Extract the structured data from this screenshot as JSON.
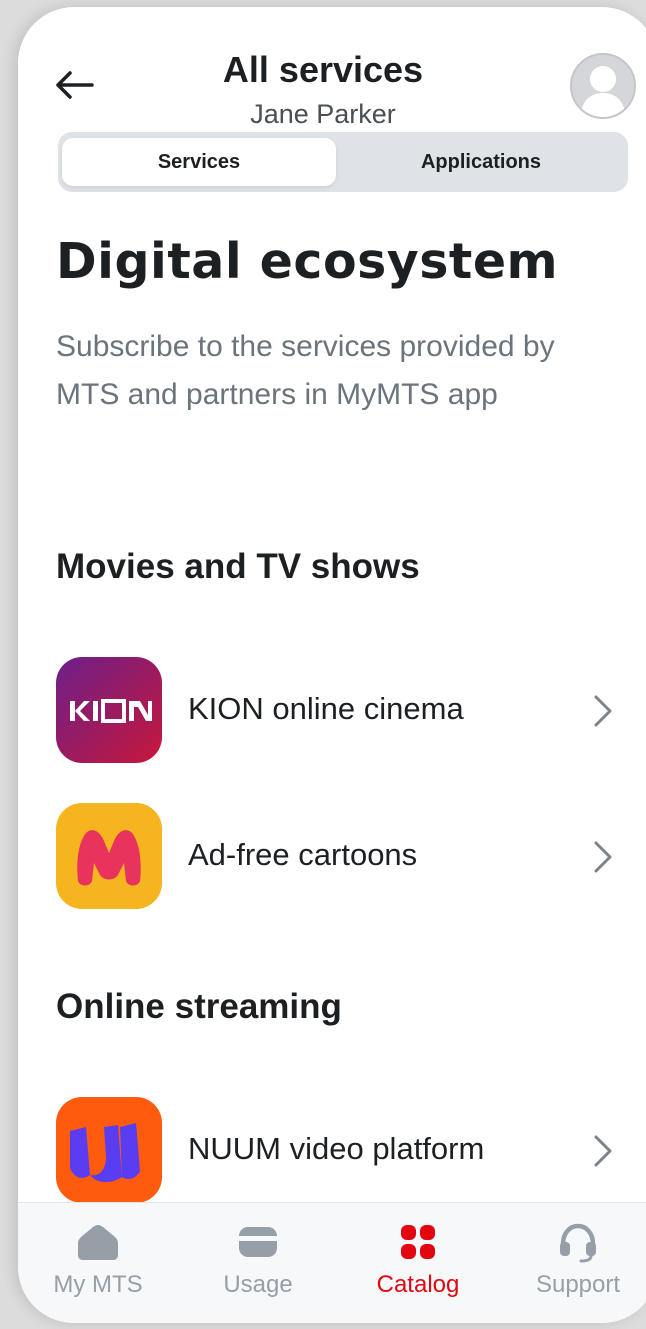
{
  "header": {
    "title": "All services",
    "subtitle": "Jane Parker"
  },
  "tabs": {
    "services": "Services",
    "applications": "Applications",
    "active": "services"
  },
  "content": {
    "heading": "Digital ecosystem",
    "description": "Subscribe to the services provided by MTS and partners in MyMTS app"
  },
  "sections": [
    {
      "title": "Movies and TV shows",
      "items": [
        {
          "label": "KION online cinema",
          "icon": "kion-logo-icon",
          "icon_text": "KI▭N"
        },
        {
          "label": "Ad-free cartoons",
          "icon": "m-cartoons-logo-icon",
          "icon_text": "M"
        }
      ]
    },
    {
      "title": "Online streaming",
      "items": [
        {
          "label": "NUUM video platform",
          "icon": "nuum-logo-icon",
          "icon_text": "UU"
        }
      ]
    }
  ],
  "bottom_nav": [
    {
      "label": "My MTS",
      "icon": "home-icon"
    },
    {
      "label": "Usage",
      "icon": "wallet-icon"
    },
    {
      "label": "Catalog",
      "icon": "catalog-grid-icon",
      "active": true
    },
    {
      "label": "Support",
      "icon": "headset-icon"
    }
  ],
  "colors": {
    "accent": "#e30611",
    "text_primary": "#1d2023",
    "text_secondary": "#6b747c",
    "nav_inactive": "#969fa8",
    "kion_gradient_start": "#6c1f8a",
    "kion_gradient_end": "#c7173a",
    "cartoons_bg": "#f6b51e",
    "cartoons_letter": "#e8345c",
    "nuum_bg": "#ff5b0f",
    "nuum_letter": "#5a3df0"
  }
}
